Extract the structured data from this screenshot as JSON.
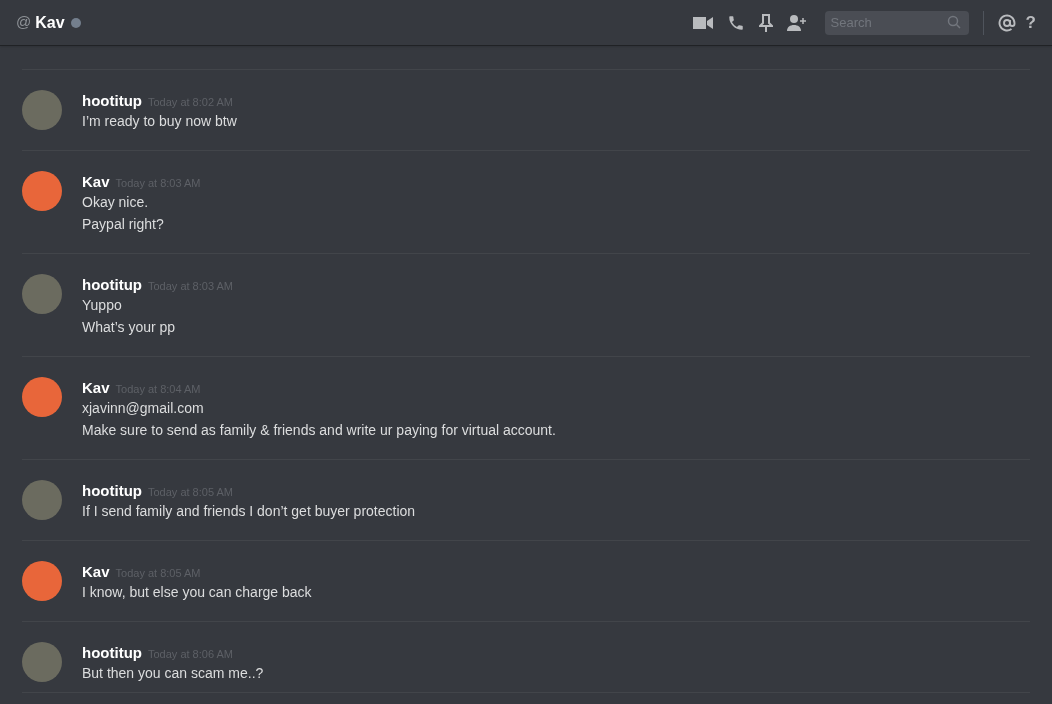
{
  "header": {
    "at_symbol": "@",
    "name": "Kav",
    "online": false,
    "search": {
      "placeholder": "Search"
    },
    "help": "?"
  },
  "messages": [
    {
      "author": "hootitup",
      "color": "#6b6b5f",
      "time": "Today at 8:02 AM",
      "lines": [
        "I’m ready to buy now btw"
      ]
    },
    {
      "author": "Kav",
      "color": "#e8663a",
      "time": "Today at 8:03 AM",
      "lines": [
        "Okay nice.",
        "Paypal right?"
      ]
    },
    {
      "author": "hootitup",
      "color": "#6b6b5f",
      "time": "Today at 8:03 AM",
      "lines": [
        "Yuppo",
        "What’s your pp"
      ]
    },
    {
      "author": "Kav",
      "color": "#e8663a",
      "time": "Today at 8:04 AM",
      "lines": [
        "xjavinn@gmail.com",
        "Make sure to send as family & friends and write ur paying for virtual account."
      ]
    },
    {
      "author": "hootitup",
      "color": "#6b6b5f",
      "time": "Today at 8:05 AM",
      "lines": [
        "If I send family and friends I don’t get buyer protection"
      ]
    },
    {
      "author": "Kav",
      "color": "#e8663a",
      "time": "Today at 8:05 AM",
      "lines": [
        "I know, but else you can charge back"
      ]
    },
    {
      "author": "hootitup",
      "color": "#6b6b5f",
      "time": "Today at 8:06 AM",
      "lines": [
        "But then you can scam me..?"
      ]
    }
  ]
}
